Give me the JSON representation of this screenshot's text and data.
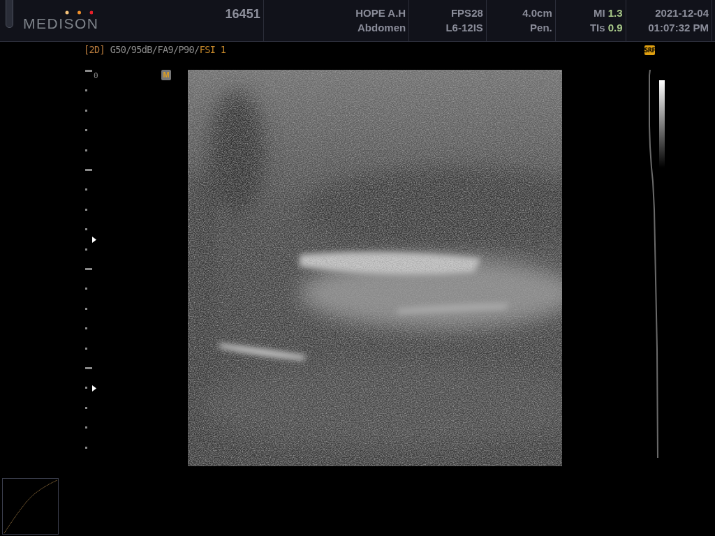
{
  "header": {
    "logo": "MEDISON",
    "exam_id": "16451",
    "columns": [
      {
        "top": "HOPE A.H",
        "bottom": "Abdomen"
      },
      {
        "top": "FPS28",
        "bottom": "L6-12IS"
      },
      {
        "top": "4.0cm",
        "bottom": "Pen."
      },
      {
        "kind": "index",
        "top_label": "MI",
        "top_value": "1.3",
        "bottom_label": "TIs",
        "bottom_value": "0.9"
      },
      {
        "top": "2021-12-04",
        "bottom": "01:07:32 PM"
      }
    ]
  },
  "parameters": {
    "mode": "[2D]",
    "settings": "G50/95dB/FA9/P90/",
    "fsi": "FSI 1"
  },
  "depth_scale": {
    "label": "0"
  },
  "marker_badge": "M",
  "srf_badge": "SRF"
}
